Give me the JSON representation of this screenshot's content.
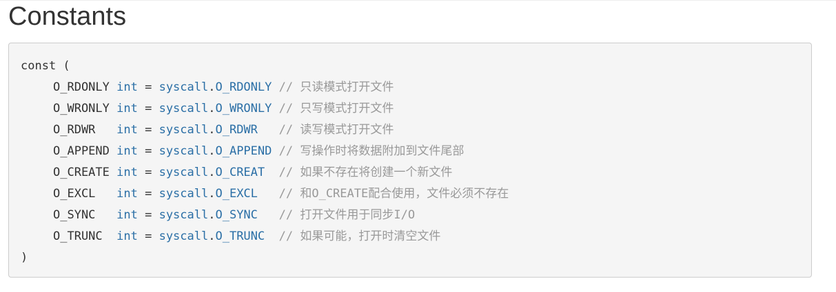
{
  "page": {
    "title": "Constants"
  },
  "code": {
    "open": "const (",
    "close": ")",
    "lines": [
      {
        "name": "O_RDONLY",
        "pad": " ",
        "type": "int",
        "eq": " = ",
        "pkg": "syscall",
        "dot": ".",
        "ref": "O_RDONLY",
        "refpad": " ",
        "slashes": "//",
        "comment": " 只读模式打开文件"
      },
      {
        "name": "O_WRONLY",
        "pad": " ",
        "type": "int",
        "eq": " = ",
        "pkg": "syscall",
        "dot": ".",
        "ref": "O_WRONLY",
        "refpad": " ",
        "slashes": "//",
        "comment": " 只写模式打开文件"
      },
      {
        "name": "O_RDWR",
        "pad": "   ",
        "type": "int",
        "eq": " = ",
        "pkg": "syscall",
        "dot": ".",
        "ref": "O_RDWR",
        "refpad": "   ",
        "slashes": "//",
        "comment": " 读写模式打开文件"
      },
      {
        "name": "O_APPEND",
        "pad": " ",
        "type": "int",
        "eq": " = ",
        "pkg": "syscall",
        "dot": ".",
        "ref": "O_APPEND",
        "refpad": " ",
        "slashes": "//",
        "comment": " 写操作时将数据附加到文件尾部"
      },
      {
        "name": "O_CREATE",
        "pad": " ",
        "type": "int",
        "eq": " = ",
        "pkg": "syscall",
        "dot": ".",
        "ref": "O_CREAT",
        "refpad": "  ",
        "slashes": "//",
        "comment": " 如果不存在将创建一个新文件"
      },
      {
        "name": "O_EXCL",
        "pad": "   ",
        "type": "int",
        "eq": " = ",
        "pkg": "syscall",
        "dot": ".",
        "ref": "O_EXCL",
        "refpad": "   ",
        "slashes": "//",
        "comment": " 和O_CREATE配合使用，文件必须不存在"
      },
      {
        "name": "O_SYNC",
        "pad": "   ",
        "type": "int",
        "eq": " = ",
        "pkg": "syscall",
        "dot": ".",
        "ref": "O_SYNC",
        "refpad": "   ",
        "slashes": "//",
        "comment": " 打开文件用于同步I/O"
      },
      {
        "name": "O_TRUNC",
        "pad": "  ",
        "type": "int",
        "eq": " = ",
        "pkg": "syscall",
        "dot": ".",
        "ref": "O_TRUNC",
        "refpad": "  ",
        "slashes": "//",
        "comment": " 如果可能，打开时清空文件"
      }
    ]
  }
}
